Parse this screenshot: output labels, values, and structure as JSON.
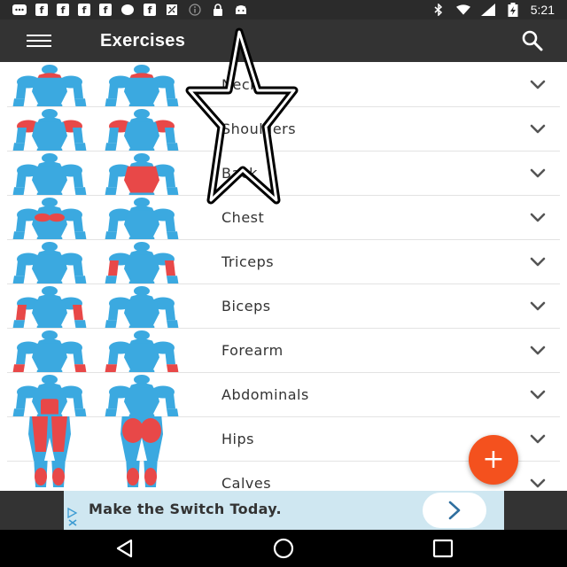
{
  "status_bar": {
    "time": "5:21",
    "left_icons": [
      "message-icon",
      "facebook-icon",
      "facebook-icon",
      "facebook-icon",
      "facebook-icon",
      "circle-icon",
      "facebook-icon",
      "satellite-icon",
      "info-icon",
      "lock-icon",
      "android-icon"
    ],
    "right_icons": [
      "bluetooth-icon",
      "wifi-icon",
      "signal-icon",
      "battery-charging-icon"
    ],
    "fb_letter": "f"
  },
  "app_bar": {
    "title": "Exercises",
    "menu_icon": "hamburger-menu-icon",
    "search_icon": "search-icon"
  },
  "exercises": [
    {
      "label": "Neck",
      "highlight": "neck"
    },
    {
      "label": "Shoulders",
      "highlight": "shoulders"
    },
    {
      "label": "Back",
      "highlight": "back"
    },
    {
      "label": "Chest",
      "highlight": "chest"
    },
    {
      "label": "Triceps",
      "highlight": "triceps"
    },
    {
      "label": "Biceps",
      "highlight": "biceps"
    },
    {
      "label": "Forearm",
      "highlight": "forearm"
    },
    {
      "label": "Abdominals",
      "highlight": "abs"
    },
    {
      "label": "Hips",
      "highlight": "hips"
    },
    {
      "label": "Calves",
      "highlight": "calves"
    }
  ],
  "fab": {
    "label": "+"
  },
  "ad": {
    "text": "Make the Switch Today.",
    "button_icon": "chevron-right-icon"
  },
  "nav_bar": {
    "icons": [
      "back-icon",
      "home-icon",
      "recents-icon"
    ]
  },
  "colors": {
    "muscle_blue": "#3ba9e0",
    "muscle_red": "#e84848",
    "app_bar": "#333333",
    "fab": "#f4511e",
    "ad_bg": "#cfe7f1"
  }
}
